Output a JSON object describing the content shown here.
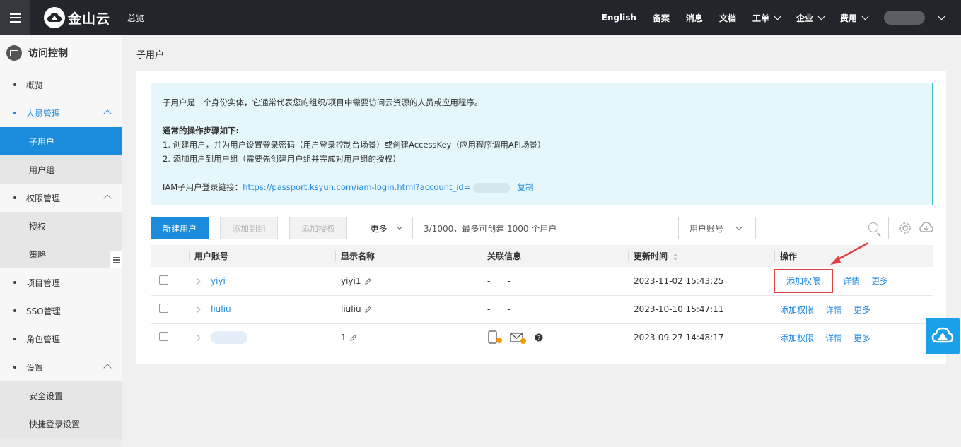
{
  "topbar": {
    "menu_icon": "hamburger-icon",
    "logo_text": "金山云",
    "overview": "总览",
    "nav": [
      {
        "label": "English",
        "dropdown": false
      },
      {
        "label": "备案",
        "dropdown": false
      },
      {
        "label": "消息",
        "dropdown": false
      },
      {
        "label": "文档",
        "dropdown": false
      },
      {
        "label": "工单",
        "dropdown": true
      },
      {
        "label": "企业",
        "dropdown": true
      },
      {
        "label": "费用",
        "dropdown": true
      }
    ]
  },
  "sidebar": {
    "title": "访问控制",
    "items": [
      {
        "label": "概览",
        "level": 1
      },
      {
        "label": "人员管理",
        "level": 1,
        "expanded": true
      },
      {
        "label": "子用户",
        "level": 2,
        "active": true
      },
      {
        "label": "用户组",
        "level": 2
      },
      {
        "label": "权限管理",
        "level": 1,
        "expanded": true
      },
      {
        "label": "授权",
        "level": 2
      },
      {
        "label": "策略",
        "level": 2
      },
      {
        "label": "项目管理",
        "level": 1
      },
      {
        "label": "SSO管理",
        "level": 1
      },
      {
        "label": "角色管理",
        "level": 1
      },
      {
        "label": "设置",
        "level": 1,
        "expanded": true
      },
      {
        "label": "安全设置",
        "level": 2
      },
      {
        "label": "快捷登录设置",
        "level": 2
      }
    ]
  },
  "page": {
    "title": "子用户"
  },
  "notice": {
    "intro": "子用户是一个身份实体，它通常代表您的组织/项目中需要访问云资源的人员或应用程序。",
    "steps_title": "通常的操作步骤如下:",
    "step1": "1. 创建用户，并为用户设置登录密码（用户登录控制台场景）或创建AccessKey（应用程序调用API场景）",
    "step2": "2. 添加用户到用户组（需要先创建用户组并完成对用户组的授权）",
    "login_label": "IAM子用户登录链接：",
    "login_url": "https://passport.ksyun.com/iam-login.html?account_id=",
    "copy": "复制"
  },
  "toolbar": {
    "new_user": "新建用户",
    "add_to_group": "添加到组",
    "add_permission": "添加授权",
    "more": "更多",
    "quota": "3/1000，最多可创建 1000 个用户",
    "search_field": "用户账号",
    "search_placeholder": ""
  },
  "table": {
    "headers": [
      "用户账号",
      "显示名称",
      "关联信息",
      "更新时间",
      "操作"
    ],
    "rows": [
      {
        "account": "yiyi",
        "display": "yiyi1",
        "related_a": "-",
        "related_b": "-",
        "updated": "2023-11-02 15:43:25",
        "add_perm": "添加权限",
        "detail": "详情",
        "more": "更多"
      },
      {
        "account": "liuliu",
        "display": "liuliu",
        "related_a": "-",
        "related_b": "-",
        "updated": "2023-10-10 15:47:11",
        "add_perm": "添加权限",
        "detail": "详情",
        "more": "更多"
      },
      {
        "account": "",
        "display": "1",
        "related_a": "",
        "related_b": "",
        "updated": "2023-09-27 14:48:17",
        "add_perm": "添加权限",
        "detail": "详情",
        "more": "更多"
      }
    ]
  },
  "colors": {
    "accent": "#1a8cdb",
    "topbar": "#22252b",
    "highlight": "#e04343"
  }
}
